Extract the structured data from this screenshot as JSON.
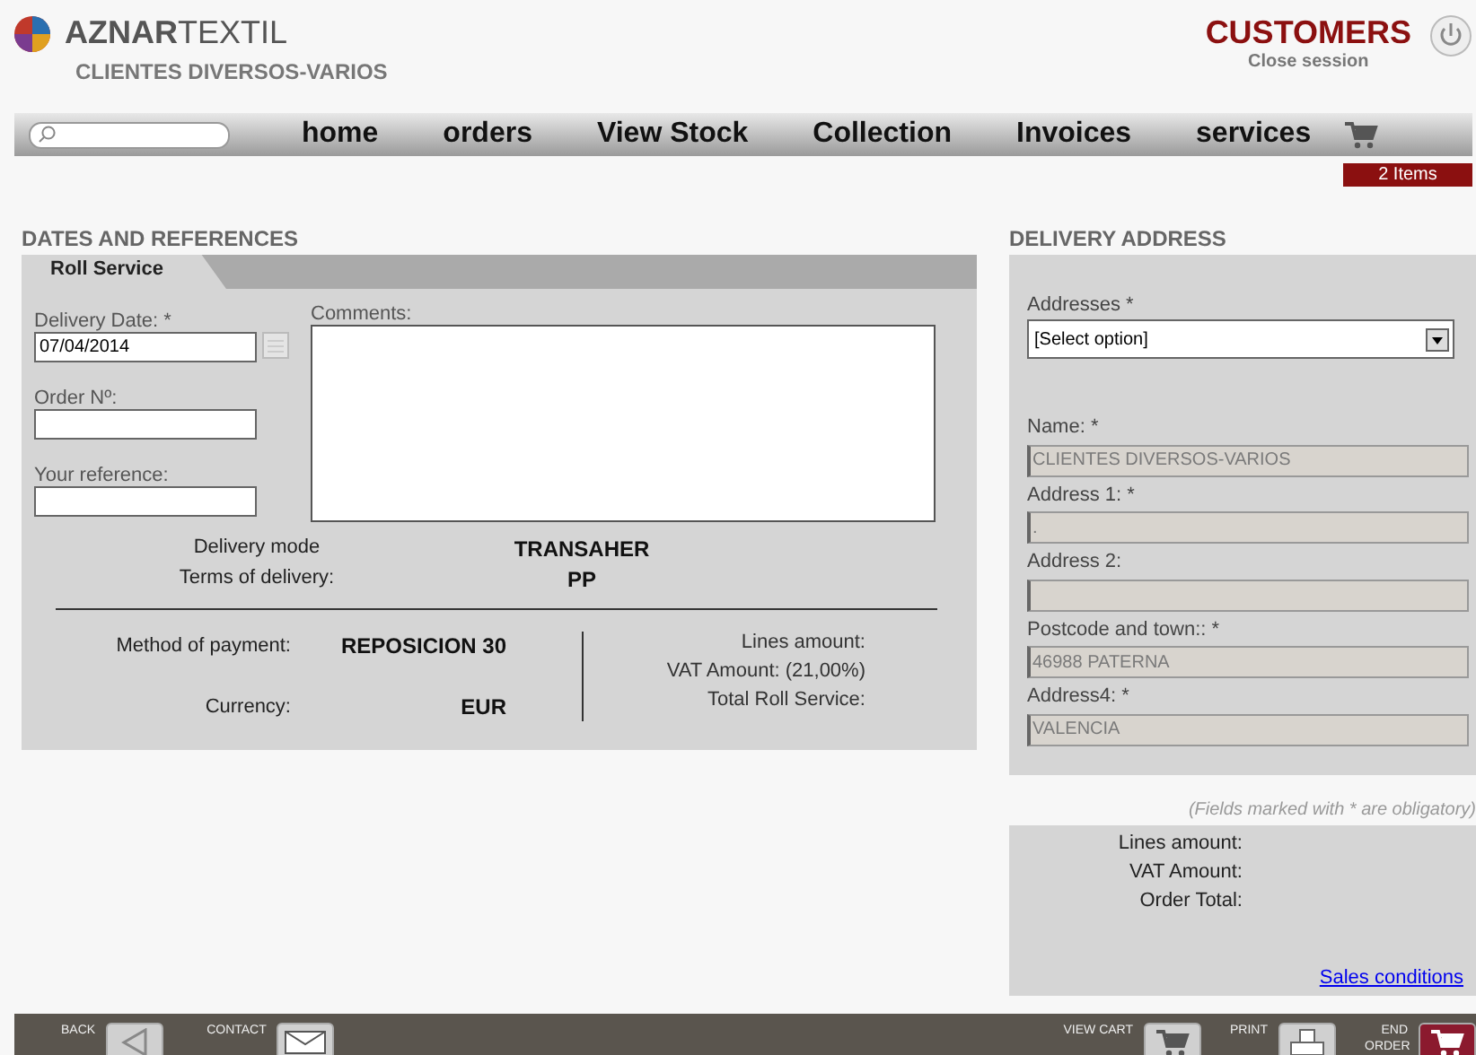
{
  "header": {
    "brand_bold": "AZNAR",
    "brand_light": "TEXTIL",
    "customer": "CLIENTES DIVERSOS-VARIOS",
    "section_title": "CUSTOMERS",
    "close_session": "Close session"
  },
  "nav": {
    "items": [
      "home",
      "orders",
      "View Stock",
      "Collection",
      "Invoices",
      "services"
    ],
    "cart_badge": "2 Items"
  },
  "dates": {
    "heading": "DATES AND REFERENCES",
    "tab": "Roll Service",
    "fields": [
      {
        "label": "Delivery Date: *",
        "value": "07/04/2014",
        "kind": "date"
      },
      {
        "label": "Order Nº:",
        "kind": "text"
      },
      {
        "label": "Your reference:",
        "kind": "text"
      }
    ],
    "comments_label": "Comments:",
    "delivery": [
      {
        "label": "Delivery mode",
        "value": "TRANSAHER"
      },
      {
        "label": "Terms of delivery:",
        "value": "PP"
      }
    ],
    "payment": [
      {
        "label": "Method of payment:",
        "value": "REPOSICION 30"
      },
      {
        "label": "Currency:",
        "value": "EUR"
      }
    ],
    "totals": [
      "Lines amount:",
      "VAT Amount: (21,00%)",
      "Total Roll Service:"
    ]
  },
  "address": {
    "heading": "DELIVERY ADDRESS",
    "select_label": "Addresses *",
    "select_value": "[Select option]",
    "fields": [
      {
        "label": "Name: *",
        "value": "CLIENTES DIVERSOS-VARIOS"
      },
      {
        "label": "Address 1: *",
        "value": "."
      },
      {
        "label": "Address 2:"
      },
      {
        "label": "Postcode and town:: *",
        "value": "46988 PATERNA"
      },
      {
        "label": "Address4: *",
        "value": "VALENCIA"
      }
    ],
    "note": "(Fields marked with * are obligatory)",
    "totals": [
      "Lines amount:",
      "VAT Amount:",
      "Order Total:"
    ],
    "link": "Sales conditions"
  },
  "footer": {
    "left": [
      {
        "label": "BACK",
        "kind": "back"
      },
      {
        "label": "CONTACT",
        "kind": "mail"
      }
    ],
    "right": [
      {
        "label": "VIEW CART",
        "kind": "cart"
      },
      {
        "label": "PRINT",
        "kind": "print"
      },
      {
        "label": "END ORDER",
        "kind": "end"
      }
    ]
  }
}
